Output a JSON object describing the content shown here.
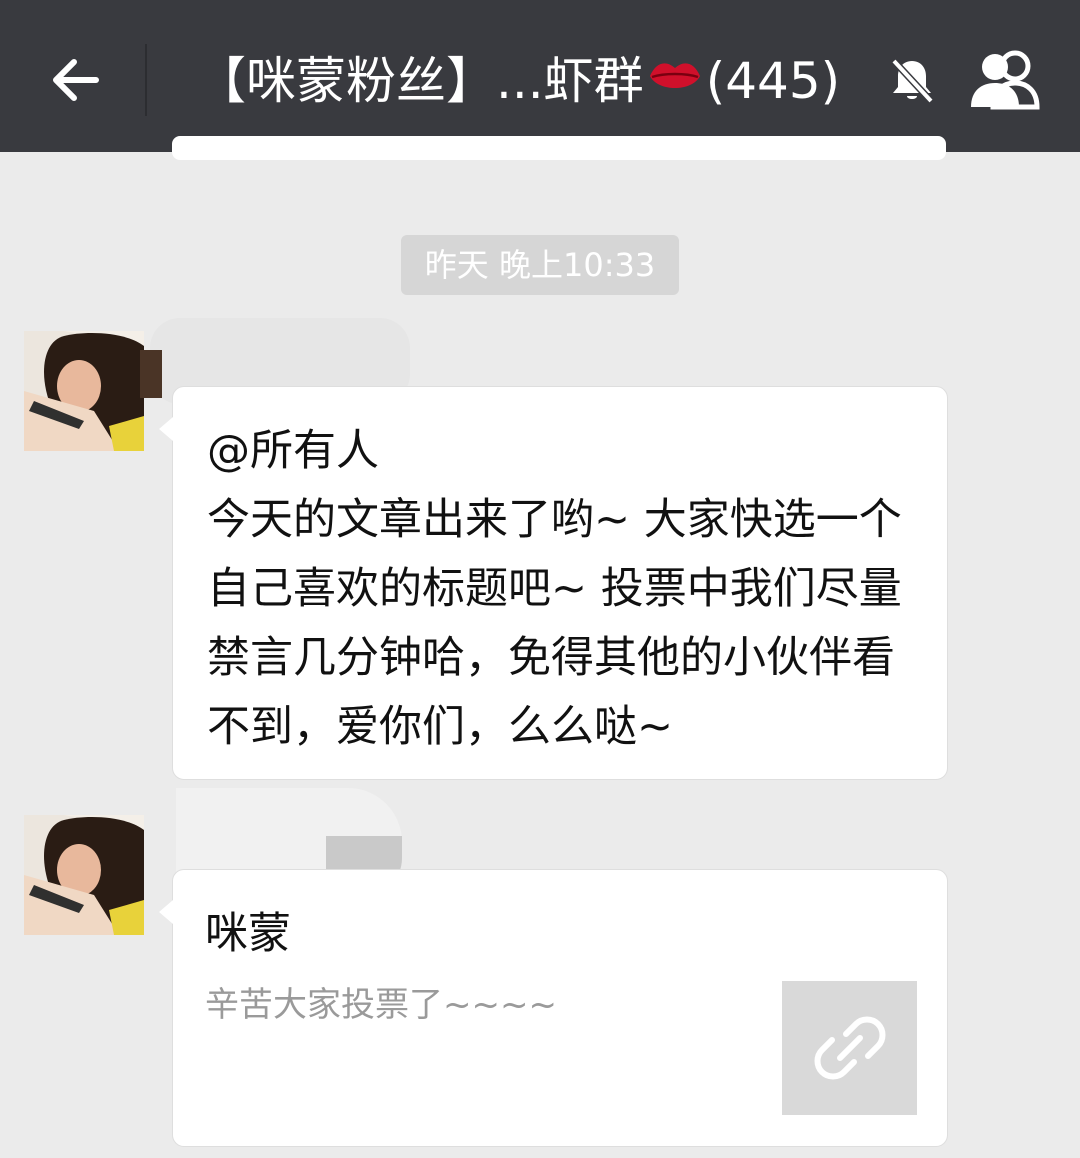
{
  "header": {
    "title_prefix": "【咪蒙粉丝】...虾群",
    "title_emoji": "💋",
    "title_count": "(445)",
    "back_icon": "arrow-left-icon",
    "mute_icon": "bell-muted-icon",
    "members_icon": "group-members-icon",
    "bar_color": "#393a3f"
  },
  "timestamp": "昨天 晚上10:33",
  "messages": [
    {
      "type": "text",
      "text": "@所有人\n今天的文章出来了哟~ 大家快选一个自己喜欢的标题吧~ 投票中我们尽量禁言几分钟哈，免得其他的小伙伴看不到，爱你们，么么哒~"
    },
    {
      "type": "link_card",
      "title": "咪蒙",
      "description": "辛苦大家投票了~~~~",
      "thumb_icon": "link-icon"
    }
  ],
  "colors": {
    "chat_background": "#ebebeb",
    "bubble": "#ffffff",
    "timestamp_bg": "#d6d6d6"
  }
}
